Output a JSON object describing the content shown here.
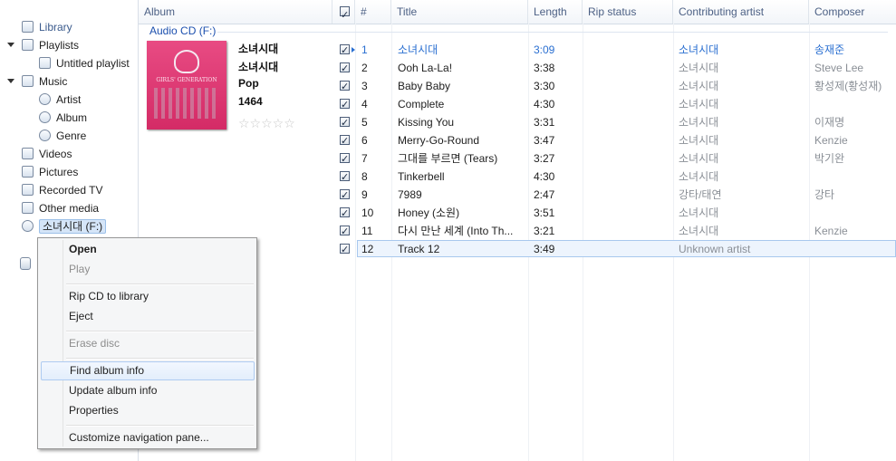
{
  "nav": {
    "library": "Library",
    "playlists": "Playlists",
    "untitled_playlist": "Untitled playlist",
    "music": "Music",
    "artist": "Artist",
    "album": "Album",
    "genre": "Genre",
    "videos": "Videos",
    "pictures": "Pictures",
    "recorded_tv": "Recorded TV",
    "other_media": "Other media",
    "cd_drive": "소녀시대 (F:)"
  },
  "columns": {
    "album": "Album",
    "number": "#",
    "title": "Title",
    "length": "Length",
    "rip_status": "Rip status",
    "contributing_artist": "Contributing artist",
    "composer": "Composer"
  },
  "group_label": "Audio CD (F:)",
  "album_info": {
    "album_title": "소녀시대",
    "artist": "소녀시대",
    "genre": "Pop",
    "year": "1464",
    "rating": "☆☆☆☆☆",
    "art_text": "GIRLS' GENERATION"
  },
  "tracks": [
    {
      "num": "1",
      "title": "소녀시대",
      "length": "3:09",
      "artist": "소녀시대",
      "composer": "송재준"
    },
    {
      "num": "2",
      "title": "Ooh La-La!",
      "length": "3:38",
      "artist": "소녀시대",
      "composer": "Steve Lee"
    },
    {
      "num": "3",
      "title": "Baby Baby",
      "length": "3:30",
      "artist": "소녀시대",
      "composer": "황성제(황성재)"
    },
    {
      "num": "4",
      "title": "Complete",
      "length": "4:30",
      "artist": "소녀시대",
      "composer": ""
    },
    {
      "num": "5",
      "title": "Kissing You",
      "length": "3:31",
      "artist": "소녀시대",
      "composer": "이재명"
    },
    {
      "num": "6",
      "title": "Merry-Go-Round",
      "length": "3:47",
      "artist": "소녀시대",
      "composer": "Kenzie"
    },
    {
      "num": "7",
      "title": "그대를 부르면 (Tears)",
      "length": "3:27",
      "artist": "소녀시대",
      "composer": "박기완"
    },
    {
      "num": "8",
      "title": "Tinkerbell",
      "length": "4:30",
      "artist": "소녀시대",
      "composer": ""
    },
    {
      "num": "9",
      "title": "7989",
      "length": "2:47",
      "artist": "강타/태연",
      "composer": "강타"
    },
    {
      "num": "10",
      "title": "Honey (소원)",
      "length": "3:51",
      "artist": "소녀시대",
      "composer": ""
    },
    {
      "num": "11",
      "title": "다시 만난 세계 (Into Th...",
      "length": "3:21",
      "artist": "소녀시대",
      "composer": "Kenzie"
    },
    {
      "num": "12",
      "title": "Track 12",
      "length": "3:49",
      "artist": "Unknown artist",
      "composer": ""
    }
  ],
  "context_menu": {
    "open": "Open",
    "play": "Play",
    "rip": "Rip CD to library",
    "eject": "Eject",
    "erase": "Erase disc",
    "find_info": "Find album info",
    "update_info": "Update album info",
    "properties": "Properties",
    "customize": "Customize navigation pane..."
  },
  "colors": {
    "accent": "#2a6fd1",
    "selection": "#d5e5f8",
    "album_art": "#e0447c"
  }
}
